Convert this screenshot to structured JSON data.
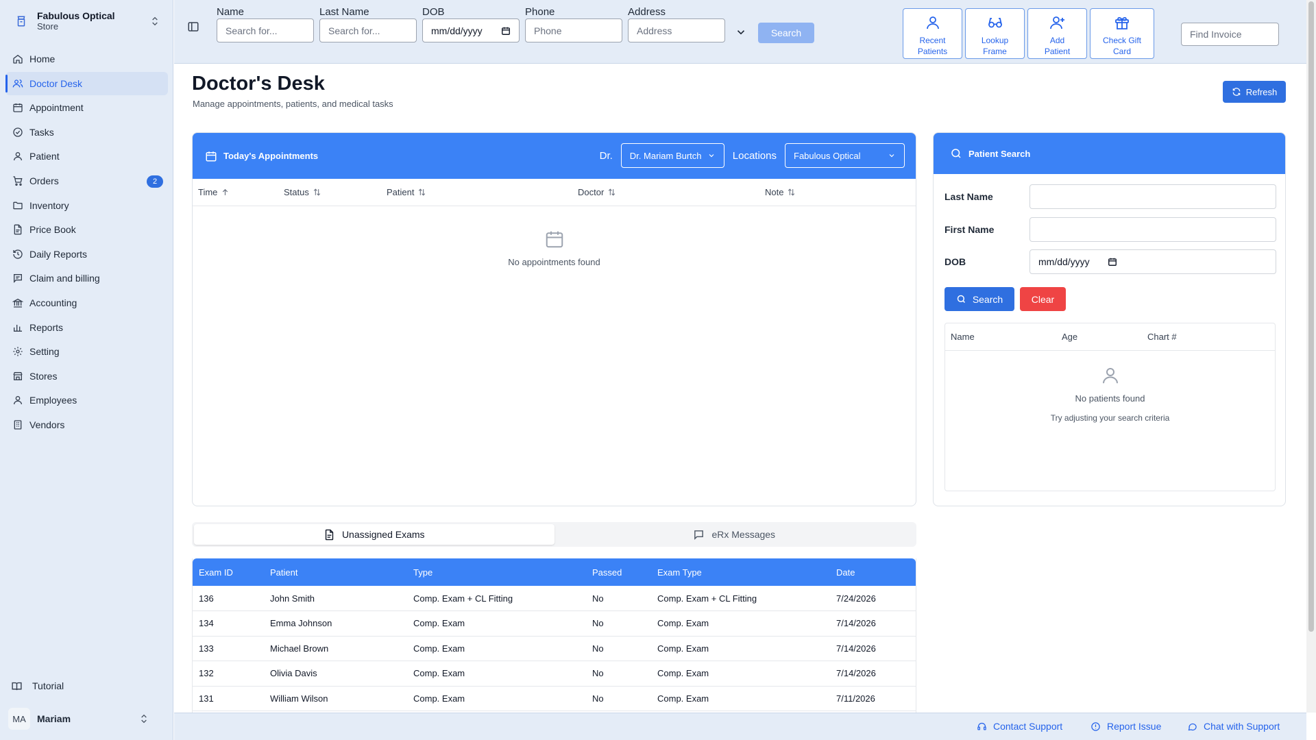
{
  "store": {
    "name": "Fabulous Optical",
    "subtitle": "Store"
  },
  "sidebar": {
    "items": [
      {
        "label": "Home",
        "icon": "home-icon"
      },
      {
        "label": "Doctor Desk",
        "icon": "users-icon",
        "active": true
      },
      {
        "label": "Appointment",
        "icon": "calendar-icon"
      },
      {
        "label": "Tasks",
        "icon": "check-circle-icon"
      },
      {
        "label": "Patient",
        "icon": "user-icon"
      },
      {
        "label": "Orders",
        "icon": "cart-icon",
        "badge": "2"
      },
      {
        "label": "Inventory",
        "icon": "folder-icon"
      },
      {
        "label": "Price Book",
        "icon": "file-icon"
      },
      {
        "label": "Daily Reports",
        "icon": "history-icon"
      },
      {
        "label": "Claim and billing",
        "icon": "message-icon"
      },
      {
        "label": "Accounting",
        "icon": "bank-icon"
      },
      {
        "label": "Reports",
        "icon": "bar-chart-icon"
      },
      {
        "label": "Setting",
        "icon": "gear-icon"
      },
      {
        "label": "Stores",
        "icon": "store-icon"
      },
      {
        "label": "Employees",
        "icon": "user-icon"
      },
      {
        "label": "Vendors",
        "icon": "building-icon"
      }
    ],
    "tutorial": "Tutorial",
    "user": {
      "initials": "MA",
      "name": "Mariam"
    }
  },
  "topbar": {
    "fields": {
      "name": {
        "label": "Name",
        "placeholder": "Search for..."
      },
      "last_name": {
        "label": "Last Name",
        "placeholder": "Search for..."
      },
      "dob": {
        "label": "DOB",
        "value": "mm/dd/yyyy"
      },
      "phone": {
        "label": "Phone",
        "placeholder": "Phone"
      },
      "address": {
        "label": "Address",
        "placeholder": "Address"
      }
    },
    "search_label": "Search",
    "quick_actions": [
      {
        "line1": "Recent",
        "line2": "Patients"
      },
      {
        "line1": "Lookup",
        "line2": "Frame"
      },
      {
        "line1": "Add",
        "line2": "Patient"
      },
      {
        "line1": "Check Gift",
        "line2": "Card"
      }
    ],
    "find_invoice_placeholder": "Find Invoice"
  },
  "page": {
    "title": "Doctor's Desk",
    "subtitle": "Manage appointments, patients, and medical tasks",
    "refresh_label": "Refresh"
  },
  "appointments": {
    "title": "Today's Appointments",
    "doctor_label": "Dr.",
    "doctor_value": "Dr. Mariam Burtch",
    "location_label": "Locations",
    "location_value": "Fabulous Optical",
    "columns": [
      "Time",
      "Status",
      "Patient",
      "Doctor",
      "Note"
    ],
    "empty_text": "No appointments found"
  },
  "patient_search": {
    "title": "Patient Search",
    "last_name_label": "Last Name",
    "first_name_label": "First Name",
    "dob_label": "DOB",
    "dob_value": "mm/dd/yyyy",
    "search_label": "Search",
    "clear_label": "Clear",
    "columns": [
      "Name",
      "Age",
      "Chart #"
    ],
    "empty_title": "No patients found",
    "empty_hint": "Try adjusting your search criteria"
  },
  "tabs": [
    {
      "label": "Unassigned Exams",
      "active": true
    },
    {
      "label": "eRx Messages"
    }
  ],
  "exams": {
    "columns": [
      "Exam ID",
      "Patient",
      "Type",
      "Passed",
      "Exam Type",
      "Date"
    ],
    "rows": [
      [
        "136",
        "John Smith",
        "Comp. Exam + CL Fitting",
        "No",
        "Comp. Exam + CL Fitting",
        "7/24/2026"
      ],
      [
        "134",
        "Emma Johnson",
        "Comp. Exam",
        "No",
        "Comp. Exam",
        "7/14/2026"
      ],
      [
        "133",
        "Michael Brown",
        "Comp. Exam",
        "No",
        "Comp. Exam",
        "7/14/2026"
      ],
      [
        "132",
        "Olivia Davis",
        "Comp. Exam",
        "No",
        "Comp. Exam",
        "7/14/2026"
      ],
      [
        "131",
        "William Wilson",
        "Comp. Exam",
        "No",
        "Comp. Exam",
        "7/11/2026"
      ]
    ]
  },
  "footer": {
    "contact": "Contact Support",
    "report": "Report Issue",
    "chat": "Chat with Support"
  },
  "colors": {
    "accent": "#2f6fe0",
    "header_blue": "#3b82f6",
    "danger": "#ef4444",
    "sidebar_bg": "#e4ecf7"
  }
}
